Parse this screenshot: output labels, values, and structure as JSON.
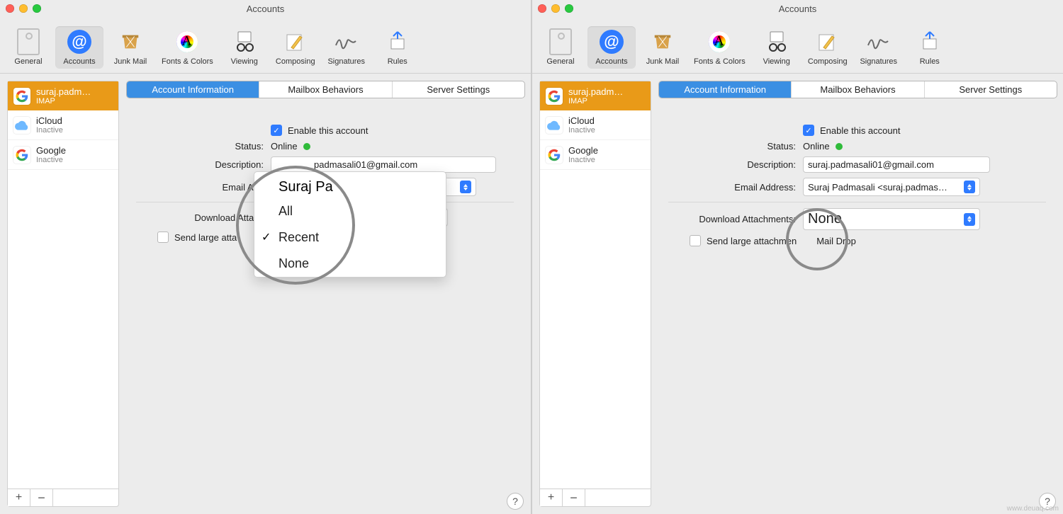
{
  "watermark": "www.deuaq.com",
  "window_title": "Accounts",
  "toolbar": {
    "general": "General",
    "accounts": "Accounts",
    "junk": "Junk Mail",
    "fonts": "Fonts & Colors",
    "viewing": "Viewing",
    "composing": "Composing",
    "signatures": "Signatures",
    "rules": "Rules"
  },
  "sidebar": {
    "accounts": [
      {
        "name": "suraj.padm…",
        "sub": "IMAP"
      },
      {
        "name": "iCloud",
        "sub": "Inactive"
      },
      {
        "name": "Google",
        "sub": "Inactive"
      }
    ],
    "add": "+",
    "remove": "−"
  },
  "tabs": {
    "info": "Account Information",
    "behaviors": "Mailbox Behaviors",
    "server": "Server Settings"
  },
  "form": {
    "enable_label": "Enable this account",
    "status_label": "Status:",
    "status_value": "Online",
    "description_label": "Description:",
    "email_label_left": "Email Add",
    "email_label_full": "Email Address:",
    "email_value_left_trunc": "Suraj Pa",
    "email_popup_value_trunc": "sali <suraj.padmas…",
    "download_label_left": "Download Attach",
    "download_label_full": "Download Attachments:",
    "maildrop_left": "Send large atta",
    "maildrop_full_left": "Send large attachmen",
    "maildrop_full_right": "Mail Drop"
  },
  "left": {
    "description_value": "padmasali01@gmail.com",
    "menu": {
      "all": "All",
      "recent": "Recent",
      "none": "None"
    }
  },
  "right": {
    "description_value": "suraj.padmasali01@gmail.com",
    "email_value": "Suraj Padmasali <suraj.padmas…",
    "download_value": "None"
  },
  "help": "?"
}
